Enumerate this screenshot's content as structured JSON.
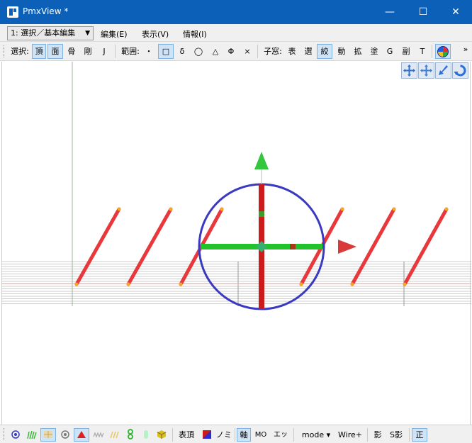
{
  "window": {
    "title": "PmxView *",
    "minimize_glyph": "—",
    "maximize_glyph": "☐",
    "close_glyph": "✕"
  },
  "menubar": {
    "mode_selected": "1: 選択／基本編集",
    "menus": [
      "編集(E)",
      "表示(V)",
      "情報(I)"
    ]
  },
  "toolbar": {
    "select_label": "選択:",
    "select_items": [
      "頂",
      "面",
      "骨",
      "剛",
      "J"
    ],
    "range_label": "範囲:",
    "range_items": [
      "・",
      "□",
      "δ",
      "◯",
      "△",
      "Φ",
      "×"
    ],
    "child_label": "子窓:",
    "child_items": [
      "表",
      "選",
      "絞",
      "動",
      "拡",
      "塗",
      "G",
      "副",
      "T"
    ],
    "overflow": "»"
  },
  "statusbar": {
    "vertex_face_label": "表頂",
    "no_label": "ノミ",
    "axis_label": "軸",
    "mo_label": "MO",
    "edge_label": "エッジ",
    "mode_label": "mode ▾",
    "wire_label": "Wire+",
    "shadow_label": "影",
    "s_shadow_label": "S影",
    "ortho_label": "正"
  },
  "colors": {
    "titlebar": "#0c60b8",
    "rigid_body": "#e8383c",
    "gizmo_ring": "#3a3ac0",
    "gizmo_y": "#cc1b1b",
    "gizmo_x": "#22c22a",
    "active_button": "#cfe3f7"
  }
}
